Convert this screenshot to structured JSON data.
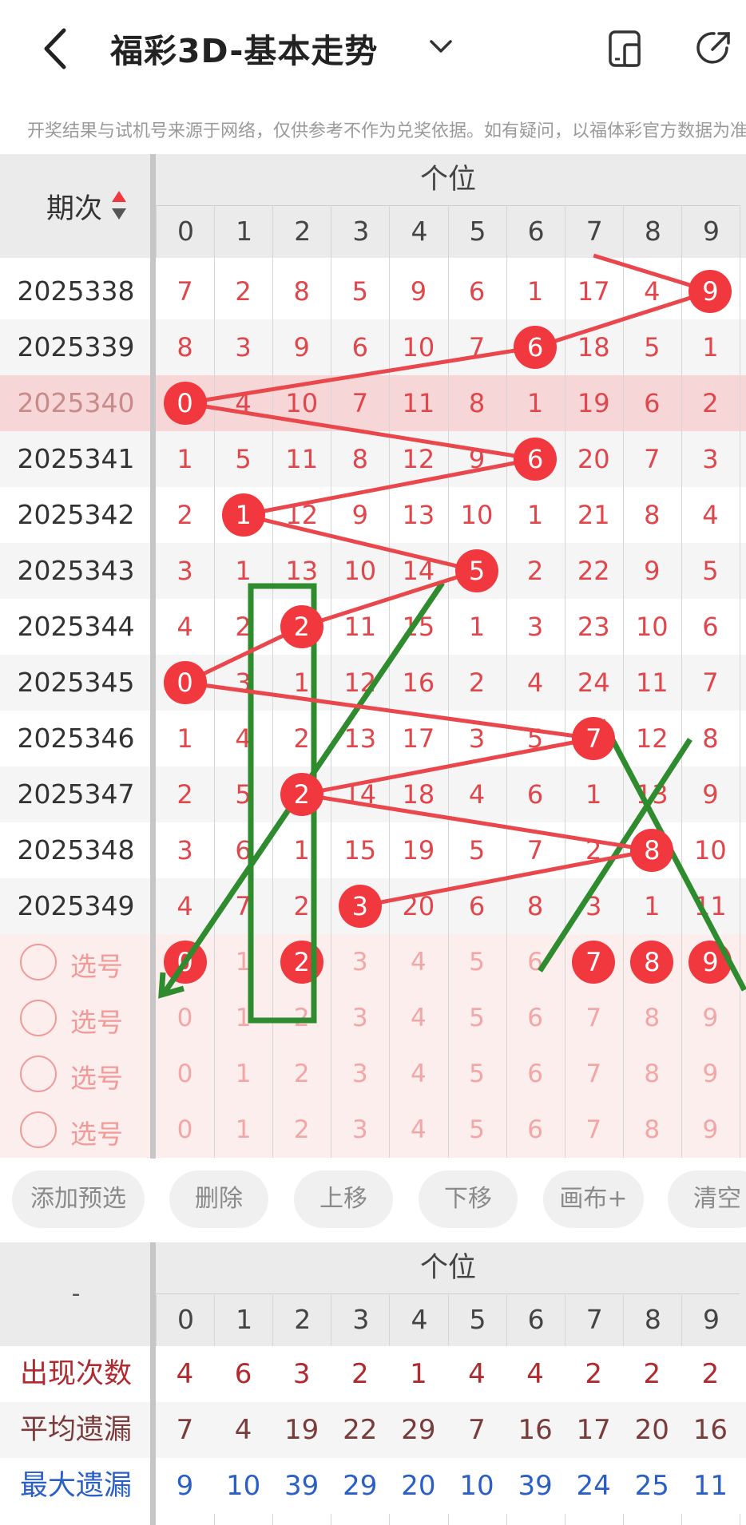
{
  "header": {
    "title": "福彩3D-基本走势",
    "back_icon": "chevron-left-icon",
    "dropdown_icon": "chevron-down-icon",
    "device_icon": "phone-layout-icon",
    "share_icon": "share-icon"
  },
  "notice": "开奖结果与试机号来源于网络，仅供参考不作为兑奖依据。如有疑问，以福体彩官方数据为准",
  "table": {
    "period_header": "期次",
    "sort_icon": "sort-icon",
    "section_header": "个位",
    "digits": [
      "0",
      "1",
      "2",
      "3",
      "4",
      "5",
      "6",
      "7",
      "8",
      "9"
    ],
    "rows": [
      {
        "period": "2025338",
        "cells": [
          "7",
          "2",
          "8",
          "5",
          "9",
          "6",
          "1",
          "17",
          "4",
          "9"
        ],
        "hit": 9
      },
      {
        "period": "2025339",
        "cells": [
          "8",
          "3",
          "9",
          "6",
          "10",
          "7",
          "6",
          "18",
          "5",
          "1"
        ],
        "hit": 6
      },
      {
        "period": "2025340",
        "cells": [
          "0",
          "4",
          "10",
          "7",
          "11",
          "8",
          "1",
          "19",
          "6",
          "2"
        ],
        "hit": 0
      },
      {
        "period": "2025341",
        "cells": [
          "1",
          "5",
          "11",
          "8",
          "12",
          "9",
          "6",
          "20",
          "7",
          "3"
        ],
        "hit": 6
      },
      {
        "period": "2025342",
        "cells": [
          "2",
          "1",
          "12",
          "9",
          "13",
          "10",
          "1",
          "21",
          "8",
          "4"
        ],
        "hit": 1
      },
      {
        "period": "2025343",
        "cells": [
          "3",
          "1",
          "13",
          "10",
          "14",
          "5",
          "2",
          "22",
          "9",
          "5"
        ],
        "hit": 5
      },
      {
        "period": "2025344",
        "cells": [
          "4",
          "2",
          "2",
          "11",
          "15",
          "1",
          "3",
          "23",
          "10",
          "6"
        ],
        "hit": 2
      },
      {
        "period": "2025345",
        "cells": [
          "0",
          "3",
          "1",
          "12",
          "16",
          "2",
          "4",
          "24",
          "11",
          "7"
        ],
        "hit": 0
      },
      {
        "period": "2025346",
        "cells": [
          "1",
          "4",
          "2",
          "13",
          "17",
          "3",
          "5",
          "7",
          "12",
          "8"
        ],
        "hit": 7
      },
      {
        "period": "2025347",
        "cells": [
          "2",
          "5",
          "2",
          "14",
          "18",
          "4",
          "6",
          "1",
          "13",
          "9"
        ],
        "hit": 2
      },
      {
        "period": "2025348",
        "cells": [
          "3",
          "6",
          "1",
          "15",
          "19",
          "5",
          "7",
          "2",
          "8",
          "10"
        ],
        "hit": 8
      },
      {
        "period": "2025349",
        "cells": [
          "4",
          "7",
          "2",
          "3",
          "20",
          "6",
          "8",
          "3",
          "1",
          "11"
        ],
        "hit": 3
      }
    ],
    "highlight_period": "2025340"
  },
  "pick_rows": [
    {
      "label": "选号",
      "numbers": [
        "0",
        "1",
        "2",
        "3",
        "4",
        "5",
        "6",
        "7",
        "8",
        "9"
      ],
      "selected": [
        0,
        2,
        7,
        8,
        9
      ]
    },
    {
      "label": "选号",
      "numbers": [
        "0",
        "1",
        "2",
        "3",
        "4",
        "5",
        "6",
        "7",
        "8",
        "9"
      ],
      "selected": []
    },
    {
      "label": "选号",
      "numbers": [
        "0",
        "1",
        "2",
        "3",
        "4",
        "5",
        "6",
        "7",
        "8",
        "9"
      ],
      "selected": []
    },
    {
      "label": "选号",
      "numbers": [
        "0",
        "1",
        "2",
        "3",
        "4",
        "5",
        "6",
        "7",
        "8",
        "9"
      ],
      "selected": []
    }
  ],
  "actions": {
    "add": "添加预选",
    "delete": "删除",
    "up": "上移",
    "down": "下移",
    "canvas": "画布+",
    "clear": "清空"
  },
  "stats": {
    "corner": "-",
    "section_header": "个位",
    "digits": [
      "0",
      "1",
      "2",
      "3",
      "4",
      "5",
      "6",
      "7",
      "8",
      "9"
    ],
    "rows": [
      {
        "label": "出现次数",
        "values": [
          "4",
          "6",
          "3",
          "2",
          "1",
          "4",
          "4",
          "2",
          "2",
          "2"
        ],
        "color": "#b02a2f"
      },
      {
        "label": "平均遗漏",
        "values": [
          "7",
          "4",
          "19",
          "22",
          "29",
          "7",
          "16",
          "17",
          "20",
          "16"
        ],
        "color": "#7a3b3b"
      },
      {
        "label": "最大遗漏",
        "values": [
          "9",
          "10",
          "39",
          "29",
          "20",
          "10",
          "39",
          "24",
          "25",
          "11"
        ],
        "color": "#2a5fc6"
      }
    ]
  },
  "colors": {
    "red": "#f1383e",
    "annotation_green": "#2e8b2e",
    "highlight_row": "#f6d6d6",
    "pick_bg": "#fdeeee"
  }
}
